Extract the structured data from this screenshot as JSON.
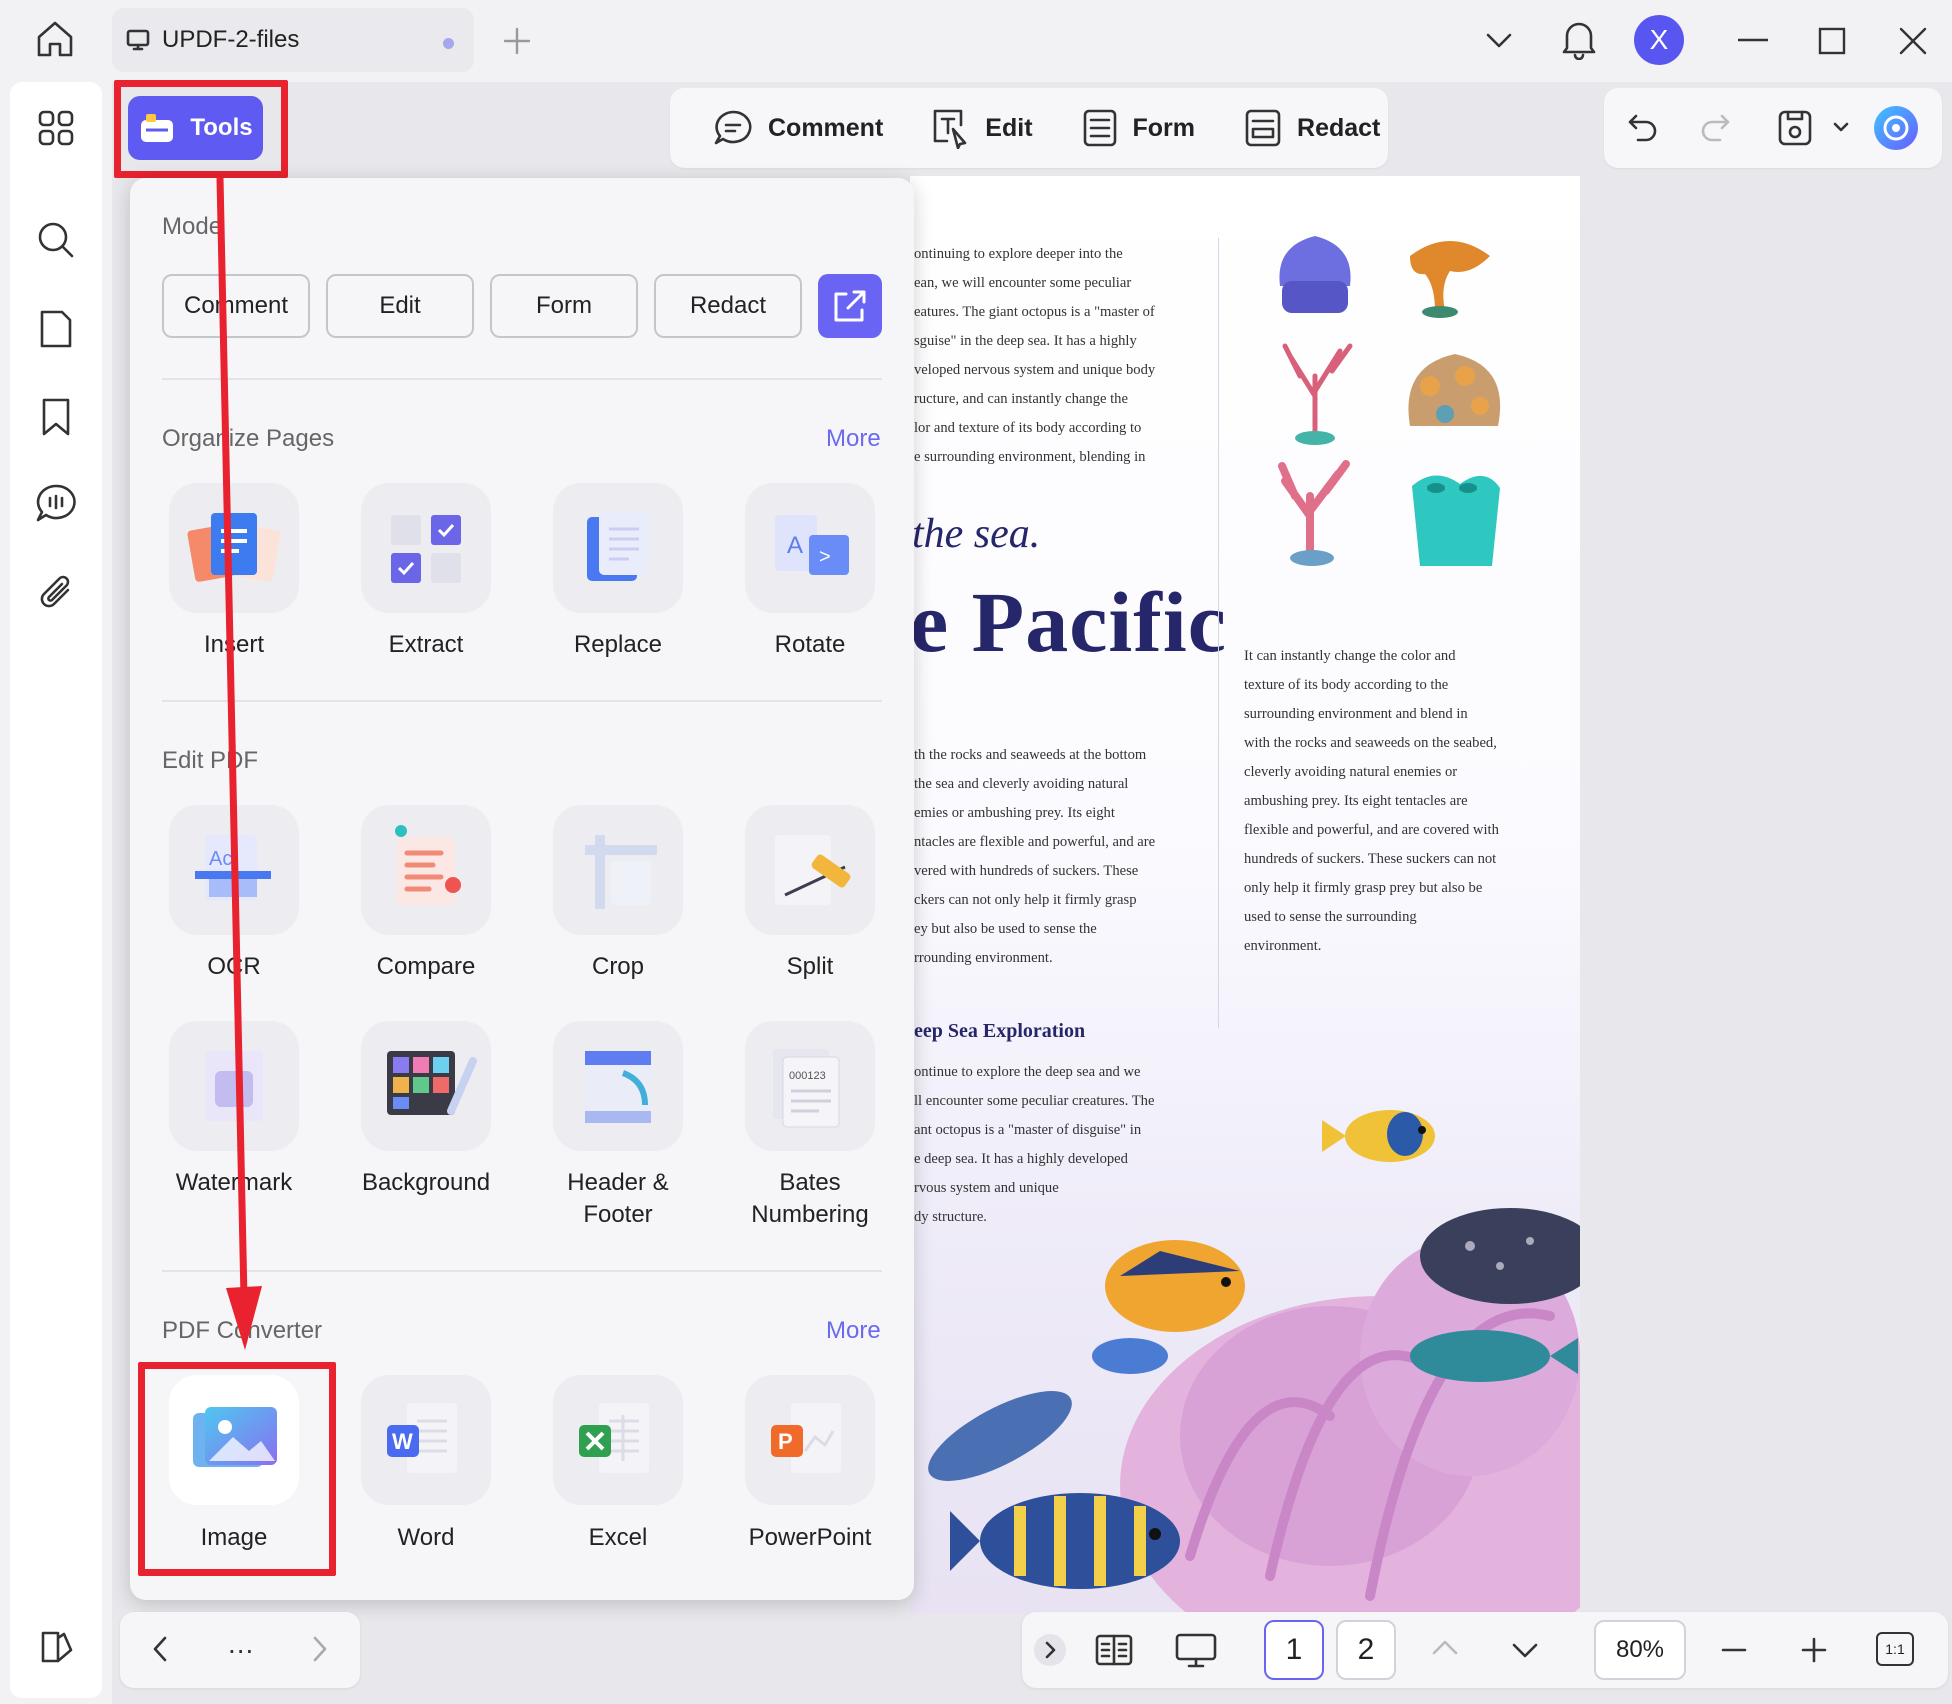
{
  "titlebar": {
    "tab_title": "UPDF-2-files",
    "avatar_letter": "X"
  },
  "toolbar": {
    "tools_label": "Tools",
    "comment_label": "Comment",
    "edit_label": "Edit",
    "form_label": "Form",
    "redact_label": "Redact"
  },
  "panel": {
    "mode_title": "Mode",
    "modes": [
      "Comment",
      "Edit",
      "Form",
      "Redact"
    ],
    "organize_title": "Organize Pages",
    "organize_more": "More",
    "organize": [
      "Insert",
      "Extract",
      "Replace",
      "Rotate"
    ],
    "edit_title": "Edit PDF",
    "edit_row1": [
      "OCR",
      "Compare",
      "Crop",
      "Split"
    ],
    "edit_row2": [
      "Watermark",
      "Background",
      "Header &",
      "Bates"
    ],
    "edit_row2_line2": [
      "Footer",
      "Numbering"
    ],
    "converter_title": "PDF Converter",
    "converter_more": "More",
    "converter": [
      "Image",
      "Word",
      "Excel",
      "PowerPoint"
    ]
  },
  "document": {
    "col1_p1": [
      "ontinuing to explore deeper into the",
      "ean, we will encounter some peculiar",
      "eatures. The giant octopus is a \"master of",
      "sguise\" in the deep sea. It has a highly",
      "veloped nervous system and unique body",
      "ructure, and can instantly change the",
      "lor and texture of its body according to",
      "e surrounding environment, blending in"
    ],
    "heading_italic": "the sea.",
    "heading_big": "e Pacific",
    "col1_p2": [
      "th the rocks and seaweeds at the bottom",
      "the sea and cleverly avoiding natural",
      "emies or ambushing prey. Its eight",
      "ntacles are flexible and powerful, and are",
      "vered with hundreds of suckers. These",
      "ckers can not only help it firmly grasp",
      "ey but also be used to sense the",
      "rrounding environment."
    ],
    "subheading": "eep Sea Exploration",
    "col1_p3": [
      "ontinue to explore the deep sea and we",
      "ll encounter some peculiar creatures. The",
      "ant octopus is a \"master of disguise\" in",
      "e deep sea. It has a highly developed",
      "rvous system and unique",
      "dy structure."
    ],
    "col2_p1": [
      "It can instantly change the color and",
      "texture of its body according to the",
      "surrounding environment and blend in",
      "with the rocks and seaweeds on the seabed,",
      "cleverly avoiding natural enemies or",
      "ambushing prey. Its eight tentacles are",
      "flexible and powerful, and are covered with",
      "hundreds of suckers. These suckers can not",
      "only help it firmly grasp prey but also be",
      "used to sense the surrounding",
      "environment."
    ]
  },
  "bottom": {
    "dots": "...",
    "page1": "1",
    "page2": "2",
    "zoom": "80%",
    "fit": "1:1"
  },
  "colors": {
    "accent": "#5f5bf2",
    "highlight": "#e8222f",
    "more_link": "#6a6af0",
    "heading": "#26266a"
  }
}
